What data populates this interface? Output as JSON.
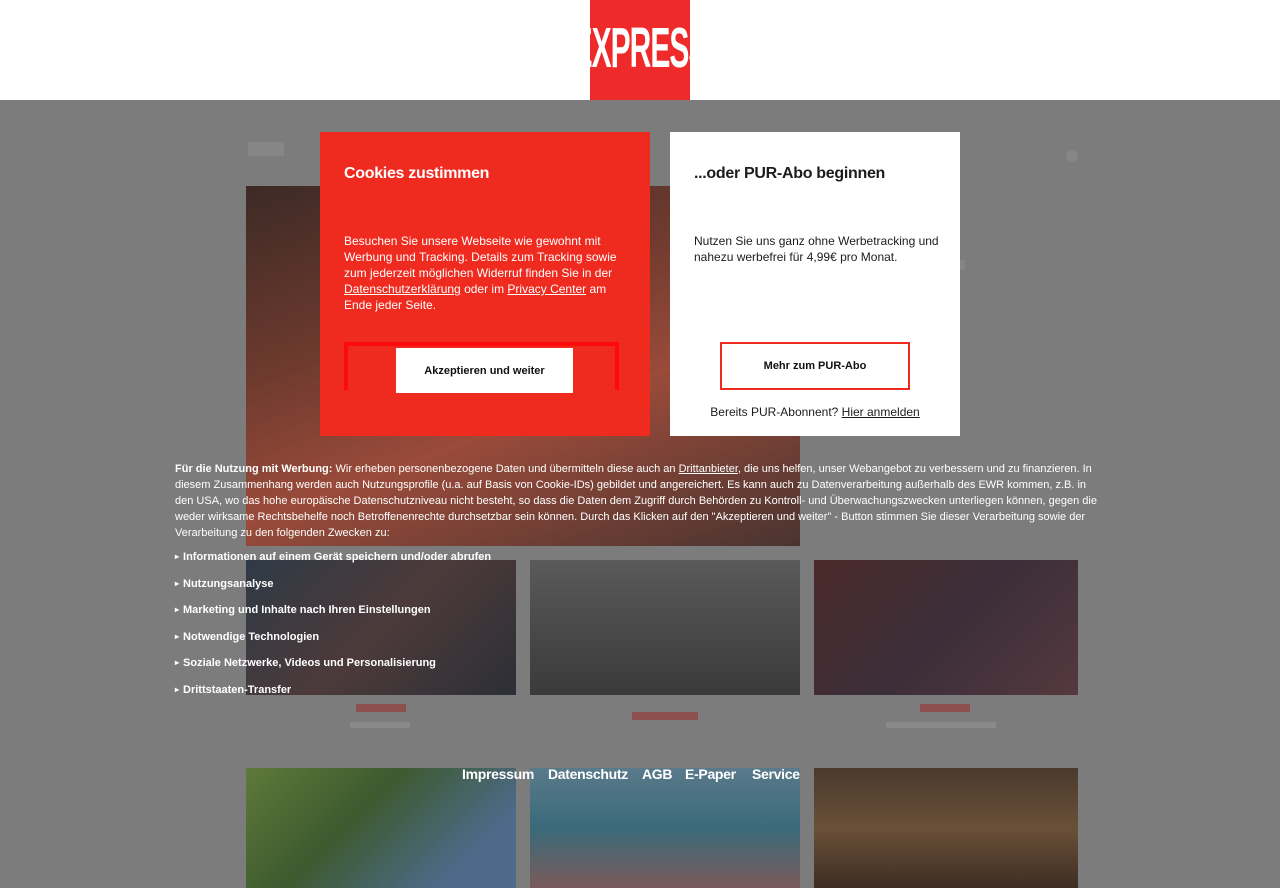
{
  "header": {
    "logo_text": "EXPRESS",
    "brand_color": "#ef2a2a"
  },
  "consent": {
    "cookies": {
      "title": "Cookies zustimmen",
      "text_before": "Besuchen Sie unsere Webseite wie gewohnt mit Werbung und Tracking. Details zum Tracking sowie zum jederzeit möglichen Widerruf finden Sie in der ",
      "privacy_link": "Datenschutzerklärung",
      "text_middle": " oder im ",
      "privacy_center_link": "Privacy Center",
      "text_after": " am Ende jeder Seite.",
      "accept_label": "Akzeptieren und weiter",
      "panel_color": "#ef2a1f"
    },
    "pur": {
      "title": "...oder PUR-Abo beginnen",
      "text": "Nutzen Sie uns ganz ohne Werbetracking und nahezu werbefrei für 4,99€ pro Monat.",
      "button_label": "Mehr zum PUR-Abo",
      "login_prefix": "Bereits PUR-Abonnent? ",
      "login_link": "Hier anmelden"
    },
    "info": {
      "lead": "Für die Nutzung mit Werbung:",
      "text_before": " Wir erheben personenbezogene Daten und übermitteln diese auch an ",
      "third_party_link": "Drittanbieter",
      "text_after": ", die uns helfen, unser Webangebot zu verbessern und zu finanzieren. In diesem Zusammenhang werden auch Nutzungsprofile (u.a. auf Basis von Cookie-IDs) gebildet und angereichert. Es kann auch zu Datenverarbeitung außerhalb des EWR kommen, z.B. in den USA, wo das hohe europäische Datenschutzniveau nicht besteht, so dass die Daten dem Zugriff durch Behörden zu Kontroll- und Überwachungszwecken unterliegen können, gegen die weder wirksame Rechtsbehelfe noch Betroffenenrechte durchsetzbar sein können. Durch das Klicken auf den \"Akzeptieren und weiter\" - Button stimmen Sie dieser Verarbeitung sowie der Verarbeitung zu den folgenden Zwecken zu:"
    },
    "purposes": [
      "Informationen auf einem Gerät speichern und/oder abrufen",
      "Nutzungsanalyse",
      "Marketing und Inhalte nach Ihren Einstellungen",
      "Notwendige Technologien",
      "Soziale Netzwerke, Videos und Personalisierung",
      "Drittstaaten-Transfer"
    ],
    "purpose_marker": "▸"
  },
  "footer": {
    "links": [
      "Impressum",
      "Datenschutz",
      "AGB",
      "E-Paper",
      "Service"
    ]
  }
}
